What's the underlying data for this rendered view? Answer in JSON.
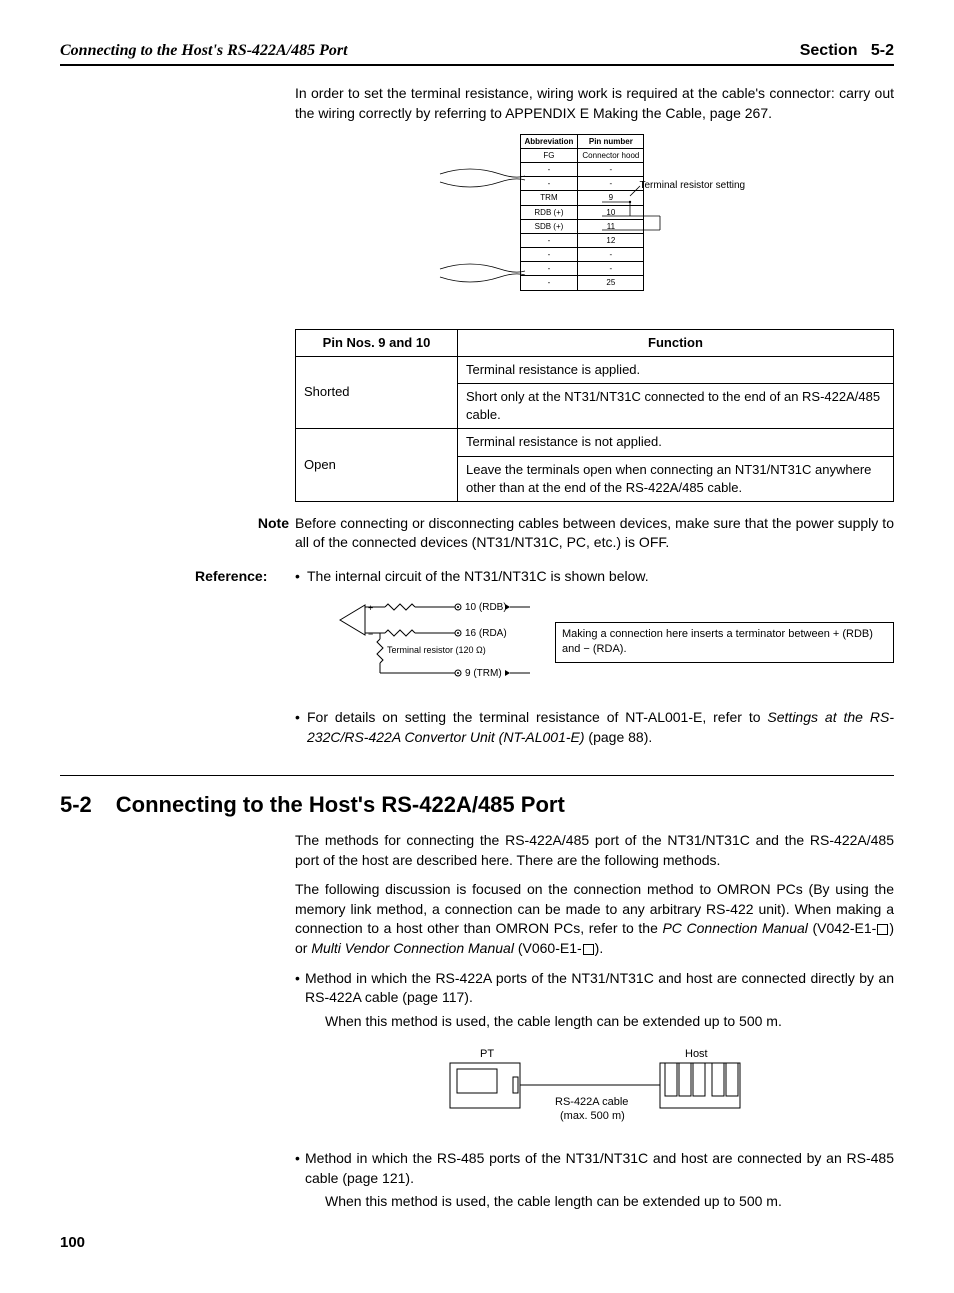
{
  "header": {
    "left": "Connecting to the Host's RS-422A/485 Port",
    "right_label": "Section",
    "right_num": "5-2"
  },
  "intro_para": "In order to set the terminal resistance, wiring work is required at the cable's connector: carry out the wiring correctly by referring to APPENDIX E Making the Cable, page 267.",
  "pin_small": {
    "head_abbr": "Abbreviation",
    "head_pin": "Pin number",
    "rows": [
      {
        "abbr": "FG",
        "pin": "Connector hood"
      },
      {
        "abbr": "-",
        "pin": "-"
      },
      {
        "abbr": "-",
        "pin": "-"
      },
      {
        "abbr": "TRM",
        "pin": "9"
      },
      {
        "abbr": "RDB (+)",
        "pin": "10"
      },
      {
        "abbr": "SDB (+)",
        "pin": "11"
      },
      {
        "abbr": "-",
        "pin": "12"
      },
      {
        "abbr": "-",
        "pin": "-"
      },
      {
        "abbr": "-",
        "pin": "-"
      },
      {
        "abbr": "-",
        "pin": "25"
      }
    ],
    "term_label": "Terminal resistor setting"
  },
  "main_table": {
    "head1": "Pin Nos. 9 and 10",
    "head2": "Function",
    "r1c1": "Shorted",
    "r1c2a": "Terminal resistance is applied.",
    "r1c2b": "Short only at the NT31/NT31C connected to the end of an RS-422A/485 cable.",
    "r2c1": "Open",
    "r2c2a": "Terminal resistance is not applied.",
    "r2c2b": "Leave the terminals open when connecting an NT31/NT31C anywhere other than at the end of the RS-422A/485 cable."
  },
  "note": {
    "label": "Note",
    "text": "Before connecting or disconnecting cables between devices, make sure that the power supply to all of the connected devices (NT31/NT31C, PC, etc.) is OFF."
  },
  "reference": {
    "label": "Reference:",
    "b1": "The internal circuit of the NT31/NT31C is shown below.",
    "circuit": {
      "pin10": "10 (RDB)",
      "pin16": "16 (RDA)",
      "term": "Terminal resistor (120 Ω)",
      "pin9": "9 (TRM)",
      "desc": "Making a connection here inserts a terminator between + (RDB) and − (RDA)."
    },
    "b2_pre": "For details on setting the terminal resistance of NT-AL001-E, refer to ",
    "b2_it": "Settings at the RS-232C/RS-422A Convertor Unit (NT-AL001-E)",
    "b2_post": " (page 88)."
  },
  "section": {
    "num": "5-2",
    "title": "Connecting to the Host's RS-422A/485 Port",
    "p1": "The methods for connecting the RS-422A/485 port of the NT31/NT31C and the RS-422A/485 port of the host are described here. There are the following methods.",
    "p2_pre": "The following discussion is focused on the connection method to OMRON PCs (By using the memory link method, a connection can be made to any arbitrary RS-422 unit). When making a connection to a host other than OMRON PCs, refer to the ",
    "p2_it1": "PC Connection Manual",
    "p2_mid1": " (V042-E1-",
    "p2_mid2": ") or ",
    "p2_it2": "Multi Vendor Connection Manual",
    "p2_mid3": " (V060-E1-",
    "p2_post": ").",
    "m1": "Method in which the RS-422A ports of the NT31/NT31C and host are connected directly by an RS-422A cable (page 117).",
    "m1_sub": "When this method is used, the cable length can be extended up to 500 m.",
    "fig": {
      "pt": "PT",
      "host": "Host",
      "cable": "RS-422A cable",
      "max": "(max. 500 m)"
    },
    "m2": "Method in which the RS-485 ports of the NT31/NT31C and host are connected by an RS-485 cable (page 121).",
    "m2_sub": "When this method is used, the cable length can be extended up to 500 m."
  },
  "page_num": "100"
}
